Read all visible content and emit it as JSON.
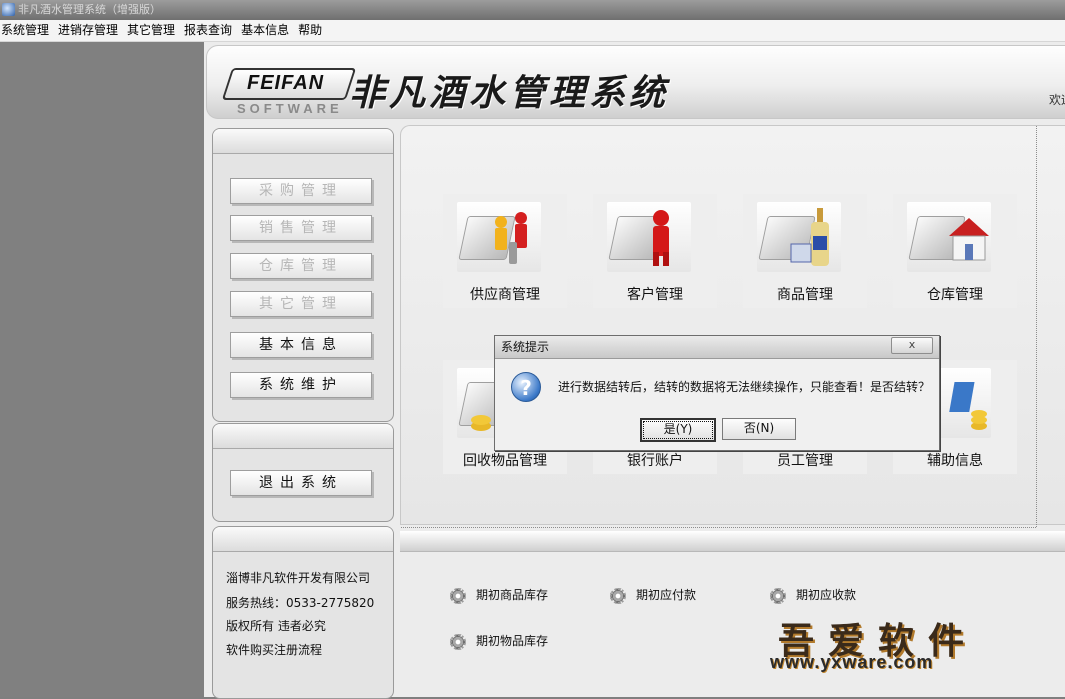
{
  "window": {
    "title": "非凡酒水管理系统（增强版）"
  },
  "menubar": [
    "系统管理",
    "进销存管理",
    "其它管理",
    "报表查询",
    "基本信息",
    "帮助"
  ],
  "header": {
    "logo_main": "FEIFAN",
    "logo_sub": "SOFTWARE",
    "system_name": "非凡酒水管理系统",
    "welcome": "欢迎"
  },
  "sidebar": {
    "buttons": [
      {
        "label": "采购管理",
        "enabled": false
      },
      {
        "label": "销售管理",
        "enabled": false
      },
      {
        "label": "仓库管理",
        "enabled": false
      },
      {
        "label": "其它管理",
        "enabled": false
      },
      {
        "label": "基本信息",
        "enabled": true
      },
      {
        "label": "系统维护",
        "enabled": true
      }
    ],
    "exit_label": "退出系统",
    "info": {
      "company": "淄博非凡软件开发有限公司",
      "hotline": "服务热线：0533-2775820",
      "copyright": "版权所有  违者必究",
      "register": "软件购买注册流程"
    }
  },
  "tiles": [
    {
      "label": "供应商管理",
      "icon": "supplier-icon"
    },
    {
      "label": "客户管理",
      "icon": "customer-icon"
    },
    {
      "label": "商品管理",
      "icon": "product-icon"
    },
    {
      "label": "仓库管理",
      "icon": "warehouse-icon"
    },
    {
      "label": "回收物品管理",
      "icon": "recycle-icon"
    },
    {
      "label": "银行账户",
      "icon": "bank-icon"
    },
    {
      "label": "员工管理",
      "icon": "staff-icon"
    },
    {
      "label": "辅助信息",
      "icon": "aux-info-icon"
    }
  ],
  "quick_links": [
    "期初商品库存",
    "期初应付款",
    "期初应收款",
    "期初物品库存"
  ],
  "dialog": {
    "title": "系统提示",
    "close_label": "x",
    "message": "进行数据结转后，结转的数据将无法继续操作，只能查看！是否结转？",
    "yes_label": "是(Y)",
    "no_label": "否(N)"
  },
  "watermark": {
    "text": "吾爱软件",
    "url": "www.yxware.com"
  }
}
